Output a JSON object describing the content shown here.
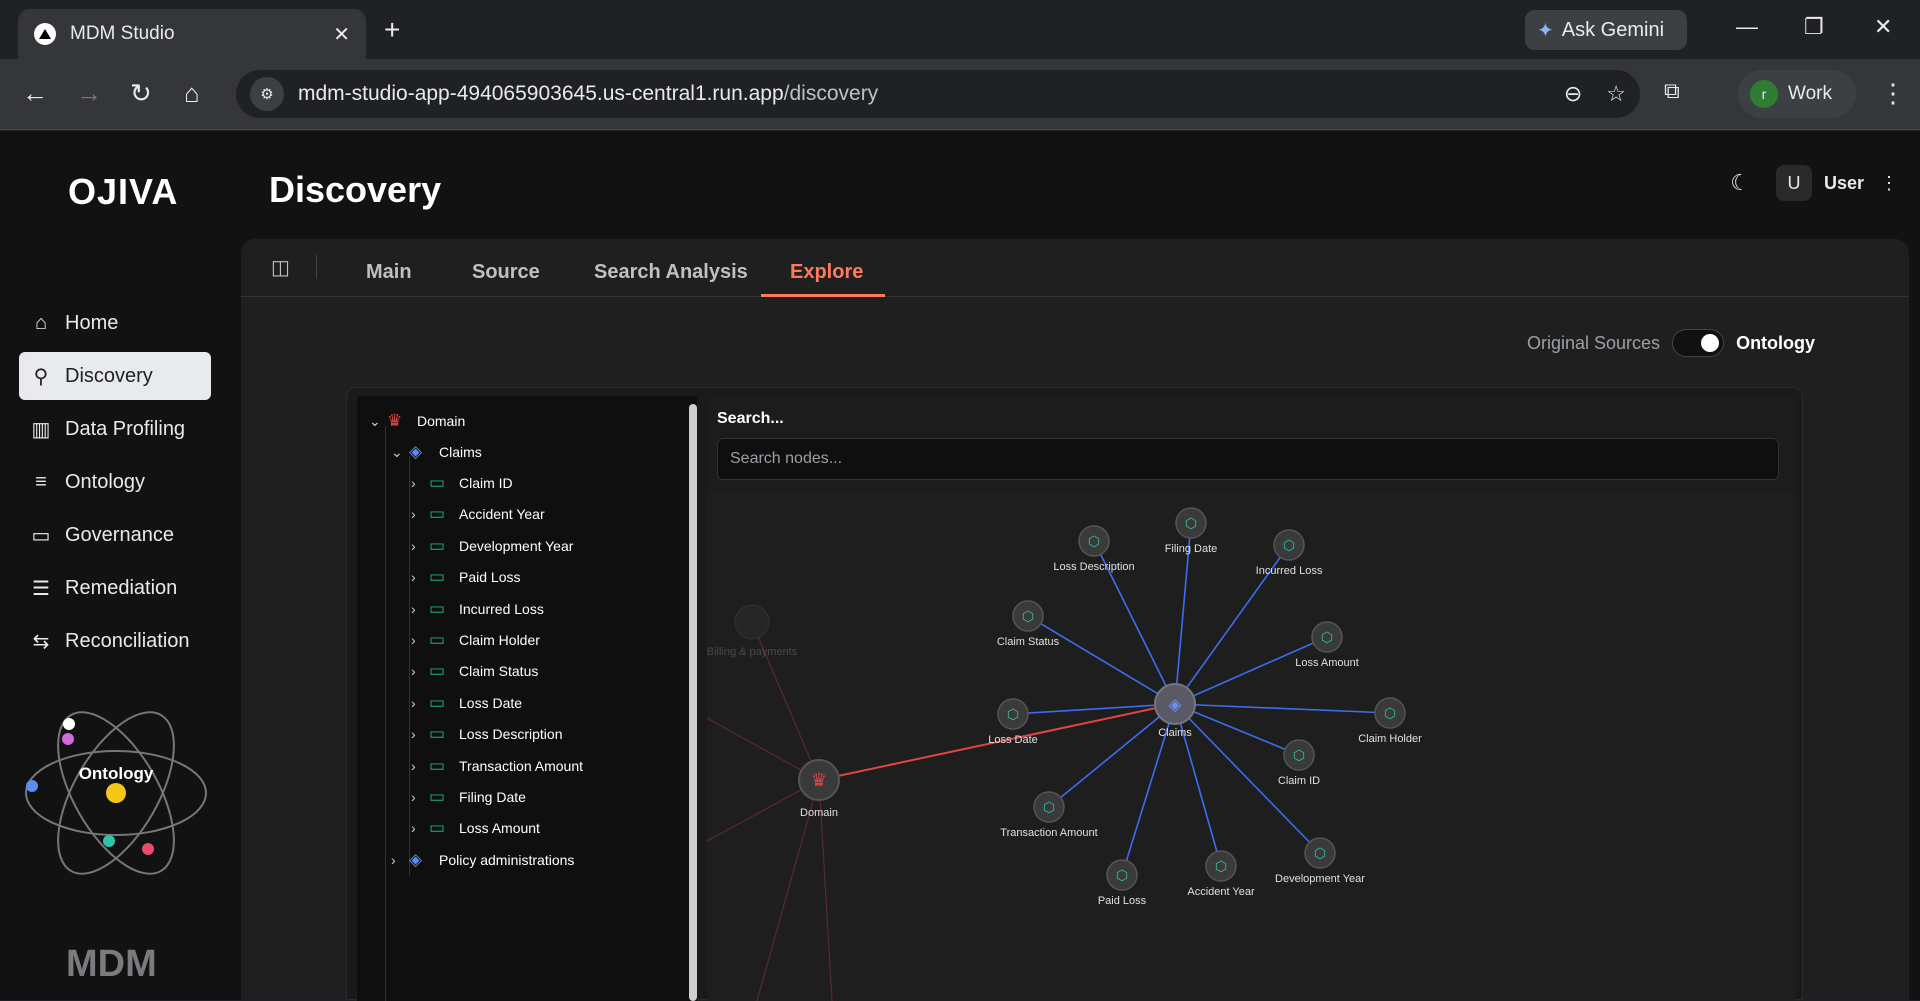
{
  "browser": {
    "tab_title": "MDM Studio",
    "ask_gemini": "Ask Gemini",
    "url_host": "mdm-studio-app-494065903645.us-central1.run.app",
    "url_path": "/discovery",
    "profile_initial": "r",
    "profile_label": "Work"
  },
  "app": {
    "logo": "OJIVA",
    "page_title": "Discovery",
    "user_initial": "U",
    "user_name": "User",
    "brand_footer": "MDM",
    "atom_label": "Ontology"
  },
  "sidebar": {
    "items": [
      {
        "label": "Home",
        "icon": "home-icon"
      },
      {
        "label": "Discovery",
        "icon": "search-icon"
      },
      {
        "label": "Data Profiling",
        "icon": "bar-chart-icon"
      },
      {
        "label": "Ontology",
        "icon": "database-icon"
      },
      {
        "label": "Governance",
        "icon": "folder-icon"
      },
      {
        "label": "Remediation",
        "icon": "list-icon"
      },
      {
        "label": "Reconciliation",
        "icon": "arrows-icon"
      }
    ]
  },
  "tabs": {
    "items": [
      "Main",
      "Source",
      "Search Analysis",
      "Explore"
    ],
    "active": "Explore"
  },
  "view_toggle": {
    "left": "Original Sources",
    "right": "Ontology"
  },
  "tree": {
    "root": "Domain",
    "claims": "Claims",
    "fields": [
      "Claim ID",
      "Accident Year",
      "Development Year",
      "Paid Loss",
      "Incurred Loss",
      "Claim Holder",
      "Claim Status",
      "Loss Date",
      "Loss Description",
      "Transaction Amount",
      "Filing Date",
      "Loss Amount"
    ],
    "policy": "Policy administrations"
  },
  "search": {
    "label": "Search...",
    "placeholder": "Search nodes..."
  },
  "graph": {
    "domain": "Domain",
    "claims": "Claims",
    "billing": "Billing & payments",
    "nodes": [
      "Filing Date",
      "Loss Description",
      "Incurred Loss",
      "Claim Status",
      "Loss Amount",
      "Loss Date",
      "Claim Holder",
      "Claim ID",
      "Transaction Amount",
      "Development Year",
      "Accident Year",
      "Paid Loss"
    ]
  },
  "colors": {
    "accent": "#ff7a5c",
    "edge_blue": "#3b6df0",
    "edge_red": "#e04545",
    "node_teal": "#2ec4a6",
    "folder_green": "#22b07a"
  }
}
